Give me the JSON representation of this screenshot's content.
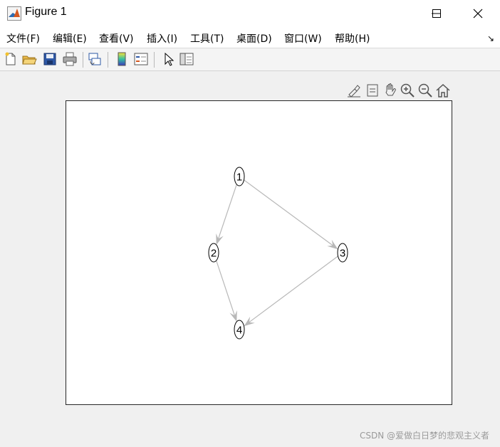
{
  "window": {
    "title": "Figure 1",
    "controls": [
      "minimize",
      "maximize",
      "close"
    ]
  },
  "menu": {
    "items": [
      {
        "label": "文件(F)",
        "icon": null
      },
      {
        "label": "编辑(E)",
        "icon": null
      },
      {
        "label": "查看(V)",
        "icon": null
      },
      {
        "label": "插入(I)",
        "icon": null
      },
      {
        "label": "工具(T)",
        "icon": null
      },
      {
        "label": "桌面(D)",
        "icon": null
      },
      {
        "label": "窗口(W)",
        "icon": null
      },
      {
        "label": "帮助(H)",
        "icon": null
      }
    ],
    "overflow_icon": "dock-arrow-icon"
  },
  "toolbar": {
    "buttons": [
      "new-figure-icon",
      "open-file-icon",
      "save-icon",
      "print-icon",
      "link-plot-icon",
      "colorbar-icon",
      "legend-icon",
      "edit-plot-icon",
      "property-inspector-icon"
    ]
  },
  "axes_toolbar": {
    "buttons": [
      "brush-icon",
      "data-tips-icon",
      "pan-icon",
      "zoom-in-icon",
      "zoom-out-icon",
      "home-icon"
    ]
  },
  "graph": {
    "nodes": [
      "1",
      "2",
      "3",
      "4"
    ],
    "edges": [
      [
        "1",
        "2"
      ],
      [
        "1",
        "3"
      ],
      [
        "2",
        "4"
      ],
      [
        "3",
        "4"
      ]
    ],
    "edge_color": "#b8b8b8",
    "node_color": "#000000"
  },
  "watermark": "CSDN @爱做白日梦的悲观主义者"
}
